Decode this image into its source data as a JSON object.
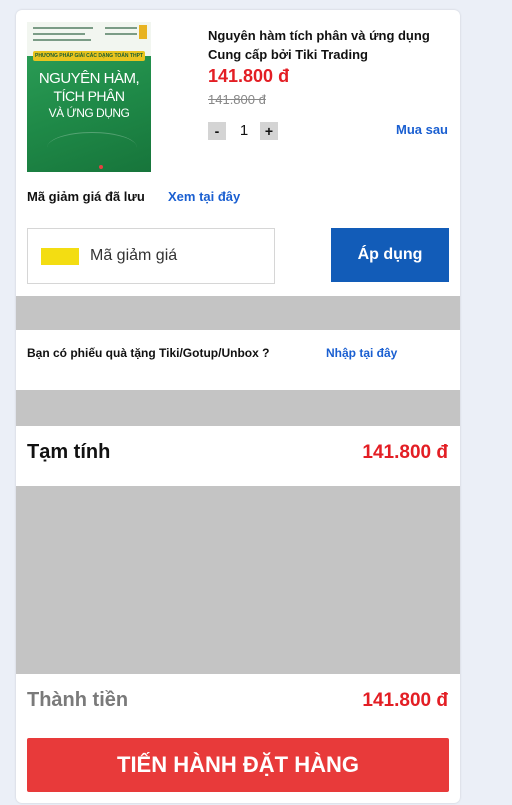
{
  "product": {
    "title_line1": "Nguyên hàm tích phân và ứng dụng",
    "seller_line": "Cung cấp bởi Tiki Trading",
    "price": "141.800 đ",
    "old_price": "141.800 đ",
    "quantity": "1",
    "minus_label": "-",
    "plus_label": "+",
    "save_later": "Mua sau",
    "cover": {
      "ribbon": "PHƯƠNG PHÁP GIẢI CÁC DẠNG TOÁN THPT",
      "line1": "NGUYÊN HÀM,",
      "line2": "TÍCH PHÂN",
      "line3": "VÀ ỨNG DỤNG"
    }
  },
  "coupon": {
    "saved_label": "Mã giảm giá đã lưu",
    "saved_link": "Xem tại đây",
    "placeholder": "Mã giảm giá",
    "apply_label": "Áp dụng",
    "icon_color": "#f3dd12"
  },
  "gift": {
    "question": "Bạn có phiếu quà tặng Tiki/Gotup/Unbox ?",
    "link": "Nhập tại đây"
  },
  "summary": {
    "subtotal_label": "Tạm tính",
    "subtotal_value": "141.800 đ",
    "total_label": "Thành tiền",
    "total_value": "141.800 đ"
  },
  "checkout_label": "TIẾN HÀNH ĐẶT HÀNG",
  "colors": {
    "accent_blue": "#125cb8",
    "link_blue": "#1a5fd1",
    "price_red": "#e31e24",
    "checkout_red": "#e83a3a",
    "page_bg": "#ebeff7"
  }
}
